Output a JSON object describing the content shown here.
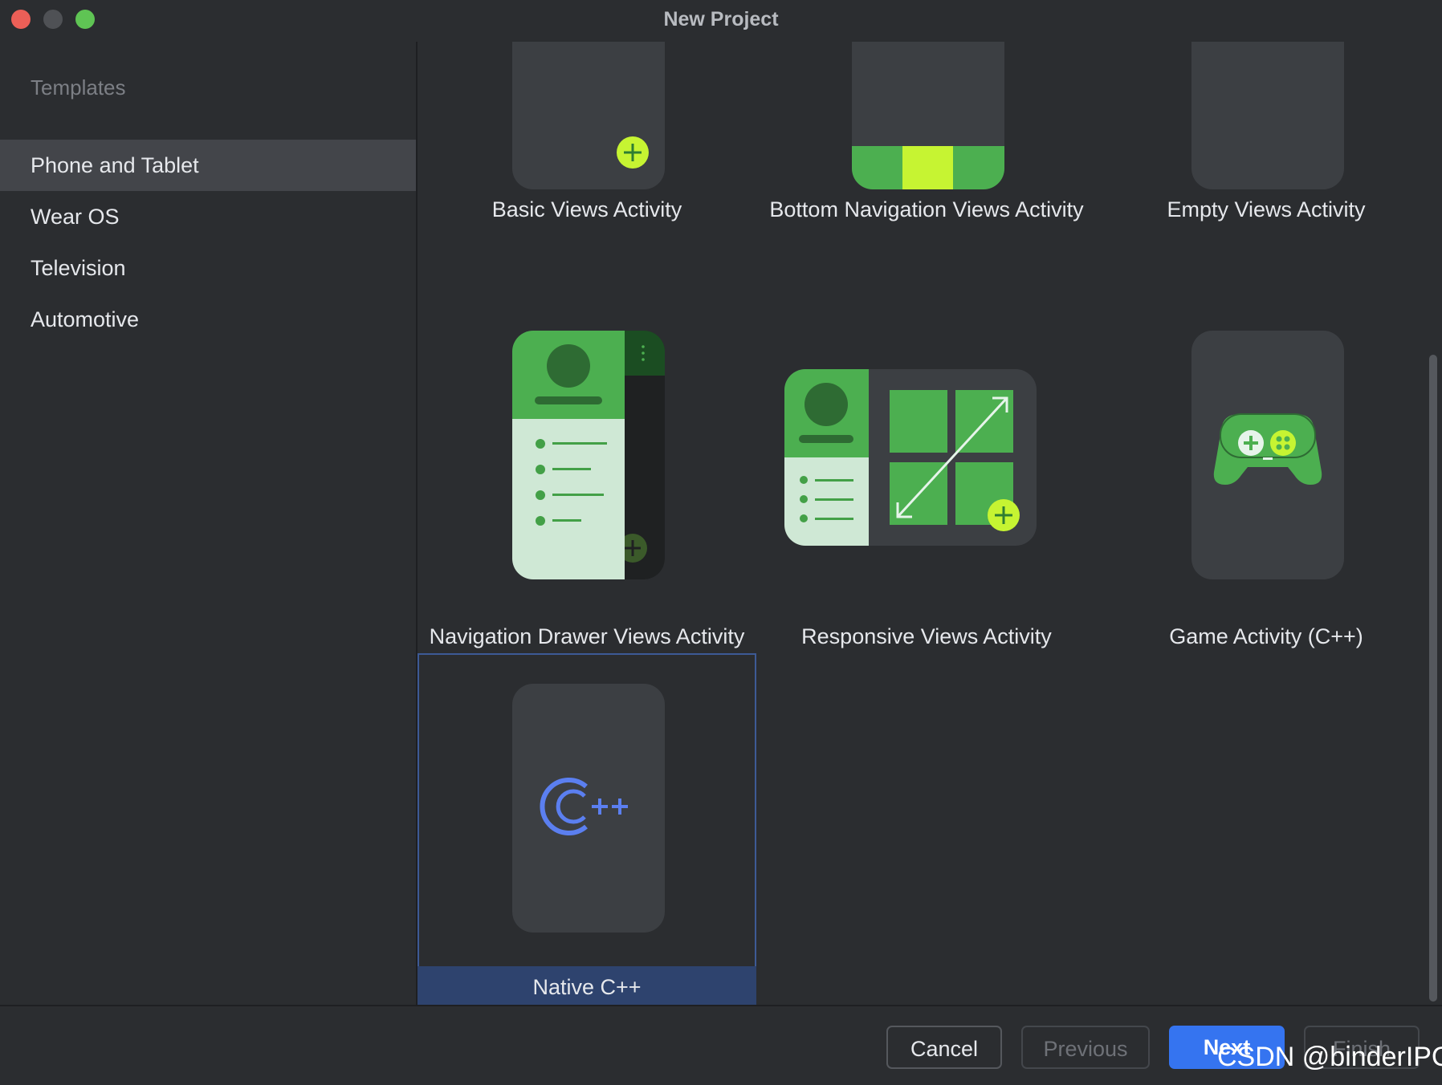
{
  "window": {
    "title": "New Project"
  },
  "sidebar": {
    "heading": "Templates",
    "items": [
      {
        "label": "Phone and Tablet",
        "selected": true
      },
      {
        "label": "Wear OS",
        "selected": false
      },
      {
        "label": "Television",
        "selected": false
      },
      {
        "label": "Automotive",
        "selected": false
      }
    ]
  },
  "templates": [
    {
      "label": "Basic Views Activity",
      "icon": "basic-views-preview"
    },
    {
      "label": "Bottom Navigation Views Activity",
      "icon": "bottom-navigation-preview"
    },
    {
      "label": "Empty Views Activity",
      "icon": "empty-views-preview"
    },
    {
      "label": "Navigation Drawer Views Activity",
      "icon": "navigation-drawer-preview"
    },
    {
      "label": "Responsive Views Activity",
      "icon": "responsive-views-preview"
    },
    {
      "label": "Game Activity (C++)",
      "icon": "game-controller-preview"
    },
    {
      "label": "Native C++",
      "icon": "cpp-logo-preview",
      "selected": true
    }
  ],
  "footer": {
    "cancel": "Cancel",
    "previous": "Previous",
    "next": "Next",
    "finish": "Finish"
  },
  "watermark": "CSDN @binderIPC",
  "colors": {
    "accent": "#3574f0",
    "green": "#4caf50",
    "lime": "#c6f432",
    "cpp_blue": "#5b7ff0",
    "selected_bg": "#2e436e"
  }
}
